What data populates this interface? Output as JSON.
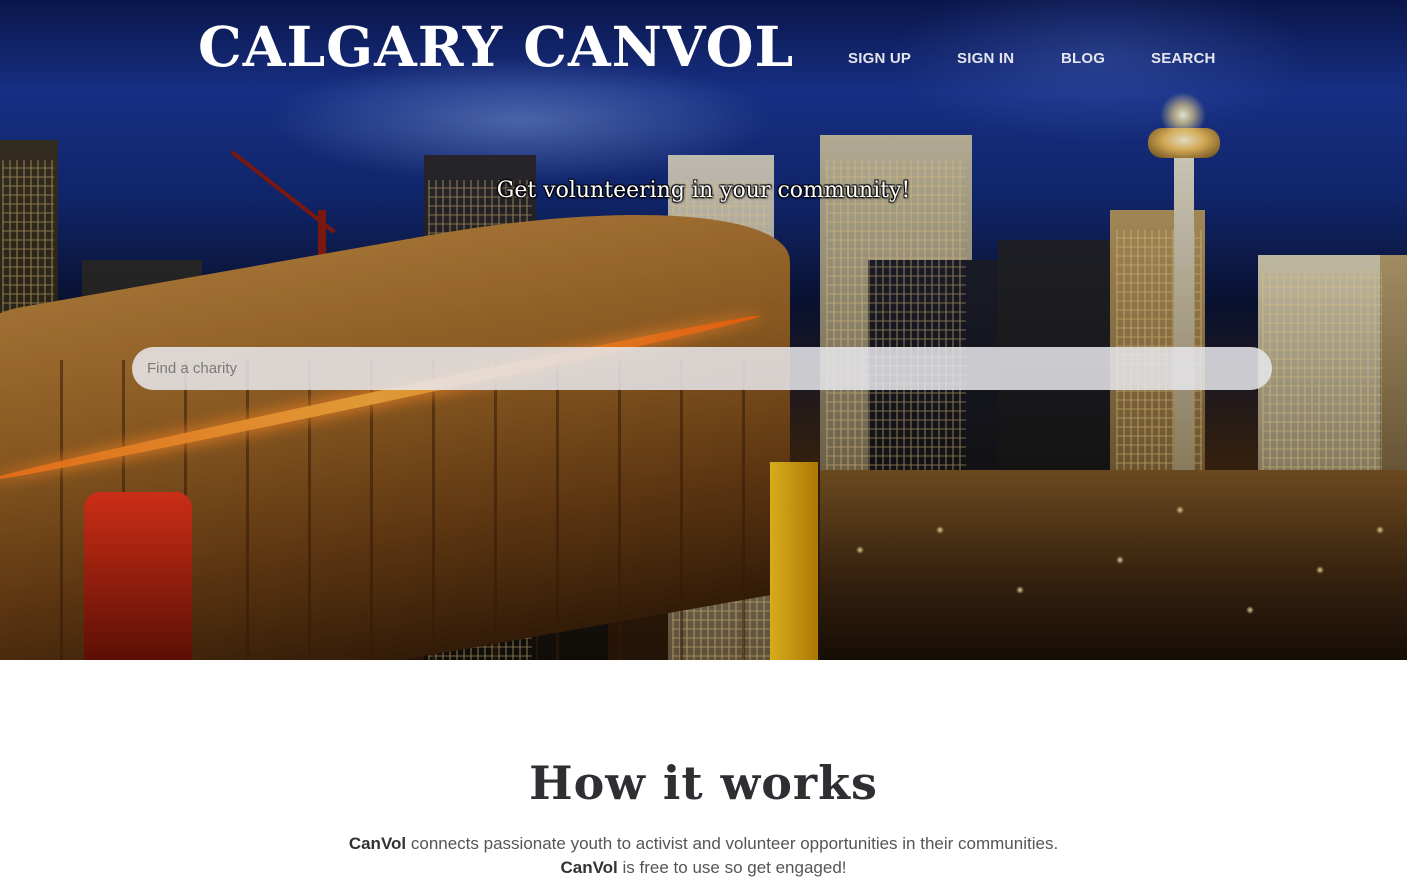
{
  "header": {
    "site_title": "CALGARY CANVOL",
    "nav": [
      {
        "label": "SIGN UP"
      },
      {
        "label": "SIGN IN"
      },
      {
        "label": "BLOG"
      },
      {
        "label": "SEARCH"
      }
    ]
  },
  "hero": {
    "tagline": "Get volunteering in your community!",
    "search_placeholder": "Find a charity"
  },
  "how_it_works": {
    "title": "How it works",
    "line1_brand": "CanVol",
    "line1_text": " connects passionate youth to activist and volunteer opportunities in their communities.",
    "line2_brand": "CanVol",
    "line2_text": " is free to use so get engaged!"
  }
}
